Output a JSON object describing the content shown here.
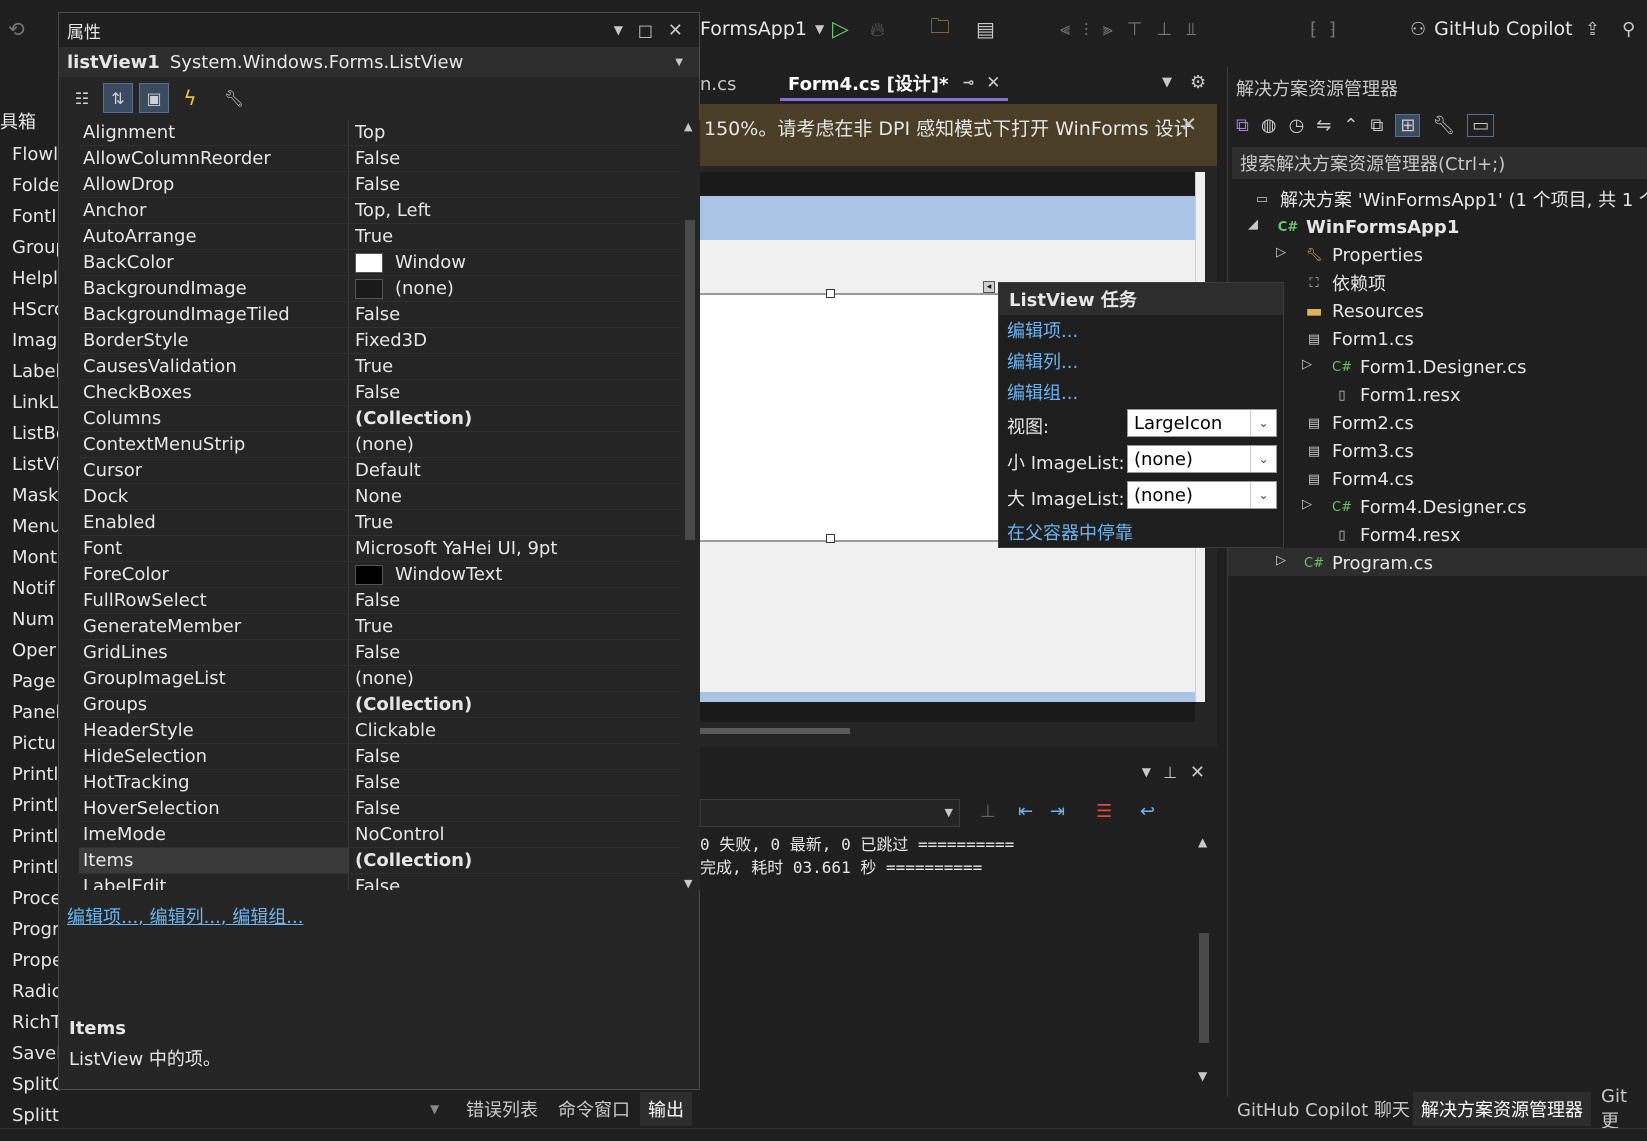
{
  "toolbar": {
    "project": "FormsApp1",
    "copilot": "GitHub Copilot"
  },
  "toolbox": {
    "title": "具箱",
    "items": [
      "Flowl",
      "Folde",
      "FontI",
      "Group",
      "Helpl",
      "HScro",
      "Imag",
      "Label",
      "LinkL",
      "ListBo",
      "ListVi",
      "Mask",
      "Menu",
      "Mont",
      "Notif",
      "Num",
      "Oper",
      "Page",
      "Panel",
      "Pictu",
      "Printl",
      "Printl",
      "Printl",
      "Printl",
      "Proce",
      "Progr",
      "Prope",
      "Radic",
      "RichT",
      "SaveF",
      "SplitContainer",
      "Splitter"
    ]
  },
  "properties": {
    "title": "属性",
    "object_name": "listView1",
    "object_type": "System.Windows.Forms.ListView",
    "rows": [
      {
        "name": "Alignment",
        "value": "Top"
      },
      {
        "name": "AllowColumnReorder",
        "value": "False"
      },
      {
        "name": "AllowDrop",
        "value": "False"
      },
      {
        "name": "Anchor",
        "value": "Top, Left"
      },
      {
        "name": "AutoArrange",
        "value": "True"
      },
      {
        "name": "BackColor",
        "value": "Window",
        "swatch": "#ffffff"
      },
      {
        "name": "BackgroundImage",
        "value": "(none)",
        "swatch": "#1a1a1a"
      },
      {
        "name": "BackgroundImageTiled",
        "value": "False"
      },
      {
        "name": "BorderStyle",
        "value": "Fixed3D"
      },
      {
        "name": "CausesValidation",
        "value": "True"
      },
      {
        "name": "CheckBoxes",
        "value": "False"
      },
      {
        "name": "Columns",
        "value": "(Collection)",
        "bold": true
      },
      {
        "name": "ContextMenuStrip",
        "value": "(none)"
      },
      {
        "name": "Cursor",
        "value": "Default"
      },
      {
        "name": "Dock",
        "value": "None"
      },
      {
        "name": "Enabled",
        "value": "True"
      },
      {
        "name": "Font",
        "value": "Microsoft YaHei UI, 9pt",
        "expand": "⊞"
      },
      {
        "name": "ForeColor",
        "value": "WindowText",
        "swatch": "#000000"
      },
      {
        "name": "FullRowSelect",
        "value": "False"
      },
      {
        "name": "GenerateMember",
        "value": "True"
      },
      {
        "name": "GridLines",
        "value": "False"
      },
      {
        "name": "GroupImageList",
        "value": "(none)"
      },
      {
        "name": "Groups",
        "value": "(Collection)",
        "bold": true
      },
      {
        "name": "HeaderStyle",
        "value": "Clickable"
      },
      {
        "name": "HideSelection",
        "value": "False"
      },
      {
        "name": "HotTracking",
        "value": "False"
      },
      {
        "name": "HoverSelection",
        "value": "False"
      },
      {
        "name": "ImeMode",
        "value": "NoControl"
      },
      {
        "name": "Items",
        "value": "(Collection)",
        "bold": true,
        "selected": true
      },
      {
        "name": "LabelEdit",
        "value": "False"
      }
    ],
    "commands": [
      "编辑项...",
      "编辑列...",
      "编辑组..."
    ],
    "description_title": "Items",
    "description_text": "ListView 中的项。"
  },
  "tabs": [
    {
      "label": "n.cs"
    },
    {
      "label": "Form4.cs [设计]*",
      "active": true
    }
  ],
  "designer": {
    "info": "150%。请考虑在非 DPI 感知模式下打开 WinForms 设计"
  },
  "listview_tasks": {
    "title": "ListView 任务",
    "links": [
      "编辑项...",
      "编辑列...",
      "编辑组..."
    ],
    "view_label": "视图:",
    "view_value": "LargeIcon",
    "small_label": "小 ImageList:",
    "small_value": "(none)",
    "large_label": "大 ImageList:",
    "large_value": "(none)",
    "dock_link": "在父容器中停靠"
  },
  "output": {
    "lines": [
      "0 失败, 0 最新, 0 已跳过 ==========",
      "完成, 耗时 03.661 秒 =========="
    ],
    "bottom_tabs": [
      "错误列表",
      "命令窗口",
      "输出"
    ]
  },
  "solution": {
    "title": "解决方案资源管理器",
    "search_placeholder": "搜索解决方案资源管理器(Ctrl+;)",
    "solution_label": "解决方案 'WinFormsApp1' (1 个项目, 共 1 个",
    "project": "WinFormsApp1",
    "items": {
      "properties": "Properties",
      "deps": "依赖项",
      "resources": "Resources",
      "form1": "Form1.cs",
      "form1_designer": "Form1.Designer.cs",
      "form1_resx": "Form1.resx",
      "form2": "Form2.cs",
      "form3": "Form3.cs",
      "form4": "Form4.cs",
      "form4_designer": "Form4.Designer.cs",
      "form4_resx": "Form4.resx",
      "program": "Program.cs"
    },
    "bottom_tabs": [
      "GitHub Copilot 聊天",
      "解决方案资源管理器",
      "Git 更"
    ]
  }
}
